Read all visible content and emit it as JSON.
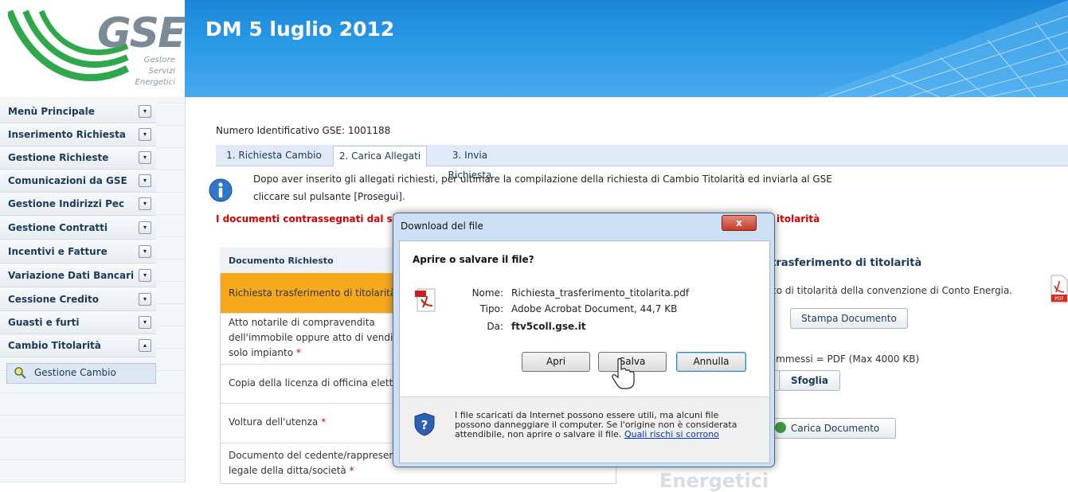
{
  "header": {
    "logo_text": "GSE",
    "logo_sub": [
      "Gestore",
      "Servizi",
      "Energetici"
    ],
    "title": "DM 5 luglio 2012"
  },
  "sidebar": {
    "items": [
      {
        "label": "Menù Principale",
        "toggle": "▾"
      },
      {
        "label": "Inserimento Richiesta",
        "toggle": "▾"
      },
      {
        "label": "Gestione Richieste",
        "toggle": "▾"
      },
      {
        "label": "Comunicazioni da GSE",
        "toggle": "▾"
      },
      {
        "label": "Gestione Indirizzi Pec",
        "toggle": "▾"
      },
      {
        "label": "Gestione Contratti",
        "toggle": "▾"
      },
      {
        "label": "Incentivi e Fatture",
        "toggle": "▾"
      },
      {
        "label": "Variazione Dati Bancari",
        "toggle": "▾"
      },
      {
        "label": "Cessione Credito",
        "toggle": "▾"
      },
      {
        "label": "Guasti e furti",
        "toggle": "▾"
      },
      {
        "label": "Cambio Titolarità",
        "toggle": "▴"
      }
    ],
    "sub_item": "Gestione Cambio"
  },
  "main": {
    "id_label": "Numero Identificativo GSE: 1001188",
    "tabs": [
      "1. Richiesta Cambio",
      "2. Carica Allegati",
      "3. Invia Richiesta"
    ],
    "info_line1": "Dopo aver inserito gli allegati richiesti, per ultimare la compilazione della richiesta di Cambio Titolarità ed inviarla al GSE",
    "info_line2": "cliccare sul pulsante [Prosegui].",
    "red_note": "I documenti contrassegnati dal simbo",
    "red_note_end": "itolarità",
    "table": {
      "header": "Documento Richiesto",
      "rows": [
        {
          "line1": "Richiesta trasferimento di titolarità",
          "line2": "",
          "line3": ""
        },
        {
          "line1": "Atto notarile di compravendita",
          "line2": "dell'immobile oppure atto di vendi",
          "line3": "solo impianto"
        },
        {
          "line1": "Copia della licenza di officina elett",
          "line2": "",
          "line3": ""
        },
        {
          "line1": "Voltura dell'utenza",
          "line2": "",
          "line3": ""
        },
        {
          "line1": "Documento del cedente/rappresen",
          "line2": "legale della ditta/società",
          "line3": ""
        }
      ],
      "required_mark": "*"
    },
    "right_panel": {
      "title": "a trasferimento di titolarità",
      "desc": "ento di titolarità della convenzione di Conto Energia.",
      "stampa_label": "Stampa Documento",
      "ammessi": "ti ammessi = PDF (Max 4000 KB)",
      "sfoglia_label": "Sfoglia",
      "carica_label": "Carica Documento",
      "pdf_label": "PDF"
    },
    "footer_watermark": "Energetici"
  },
  "dialog": {
    "title": "Download del file",
    "close_label": "x",
    "question": "Aprire o salvare il file?",
    "nome_key": "Nome:",
    "nome_val": "Richiesta_trasferimento_titolarita.pdf",
    "tipo_key": "Tipo:",
    "tipo_val": "Adobe Acrobat Document, 44,7 KB",
    "da_key": "Da:",
    "da_val": "ftv5coll.gse.it",
    "btn_apri": "Apri",
    "btn_salva": "Salva",
    "btn_annulla": "Annulla",
    "warning": "I file scaricati da Internet possono essere utili, ma alcuni file possono danneggiare il computer. Se l'origine non è considerata attendibile, non aprire o salvare il file.",
    "warning_link": "Quali rischi si corrono"
  },
  "colors": {
    "header_blue": "#1c86d8",
    "selected_row": "#f6a91b",
    "required_red": "#d40000",
    "logo_green": "#2ea84a"
  }
}
